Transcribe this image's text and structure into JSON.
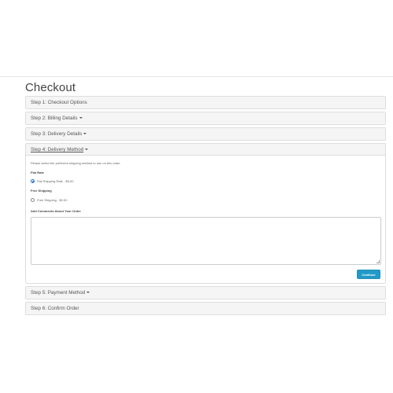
{
  "page": {
    "title": "Checkout"
  },
  "steps": [
    {
      "label": "Step 1: Checkout Options",
      "has_caret": false
    },
    {
      "label": "Step 2: Billing Details",
      "has_caret": true
    },
    {
      "label": "Step 3: Delivery Details",
      "has_caret": true
    },
    {
      "label": "Step 4: Delivery Method",
      "has_caret": true
    },
    {
      "label": "Step 5: Payment Method",
      "has_caret": true
    },
    {
      "label": "Step 6: Confirm Order",
      "has_caret": false
    }
  ],
  "delivery": {
    "instruction": "Please select the preferred shipping method to use on this order.",
    "methods": [
      {
        "title": "Flat Rate",
        "option": "Flat Shipping Rate - $5.00",
        "checked": true
      },
      {
        "title": "Free Shipping",
        "option": "Free Shipping - $0.00",
        "checked": false
      }
    ],
    "comments_label": "Add Comments About Your Order",
    "comments_value": "",
    "continue_label": "Continue"
  },
  "colors": {
    "accent": "#229ac8",
    "panel_heading_bg": "#f5f5f5",
    "border": "#dddddd"
  },
  "icons": {
    "caret": "caret-down-icon",
    "radio": "radio-icon",
    "resize": "resize-handle-icon"
  }
}
